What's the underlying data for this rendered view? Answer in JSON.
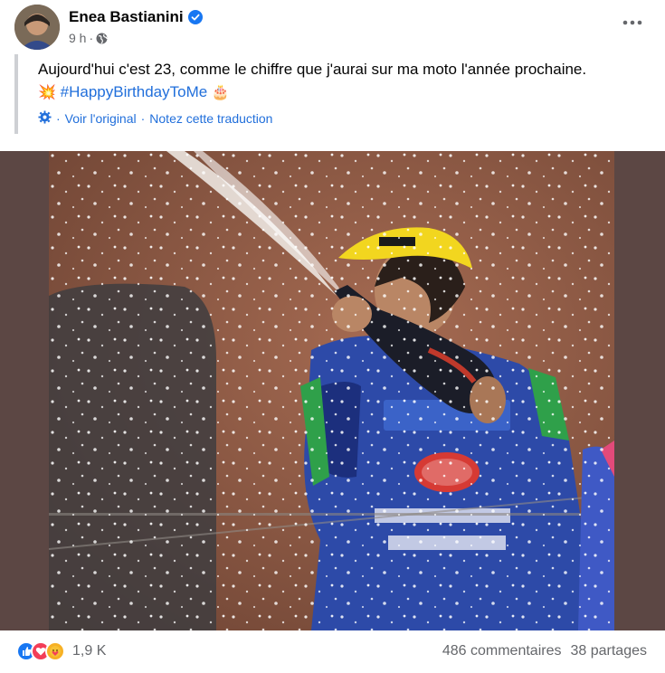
{
  "post": {
    "author": "Enea Bastianini",
    "time": "9 h",
    "time_separator": "·",
    "text": "Aujourd'hui c'est 23, comme le chiffre que j'aurai sur ma moto l'année prochaine.",
    "hashtag": "#HappyBirthdayToMe",
    "emoji_before": "💥",
    "emoji_after": "🎂",
    "translation": {
      "see_original": "Voir l'original",
      "separator": "·",
      "rate": "Notez cette traduction"
    }
  },
  "footer": {
    "reaction_count": "1,9 K",
    "comments": "486 commentaires",
    "shares": "38 partages",
    "reactions": [
      "like-icon",
      "love-icon",
      "care-icon"
    ]
  },
  "colors": {
    "link_blue": "#216fdb",
    "secondary_text": "#65676b",
    "verified_blue": "#1877f2",
    "media_background": "#5c4744"
  }
}
